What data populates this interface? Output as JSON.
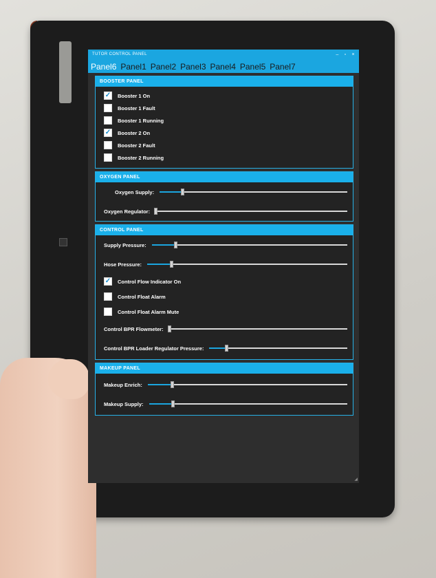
{
  "window": {
    "title": "TUTOR CONTROL PANEL",
    "controls": [
      "–",
      "▫",
      "×"
    ]
  },
  "tabs": [
    "Panel6",
    "Panel1",
    "Panel2",
    "Panel3",
    "Panel4",
    "Panel5",
    "Panel7"
  ],
  "booster": {
    "title": "BOOSTER PANEL",
    "items": [
      {
        "label": "Booster 1 On",
        "checked": true
      },
      {
        "label": "Booster 1 Fault",
        "checked": false
      },
      {
        "label": "Booster 1 Running",
        "checked": false
      },
      {
        "label": "Booster 2 On",
        "checked": true
      },
      {
        "label": "Booster 2 Fault",
        "checked": false
      },
      {
        "label": "Booster 2 Running",
        "checked": false
      }
    ]
  },
  "oxygen": {
    "title": "OXYGEN PANEL",
    "sliders": [
      {
        "label": "Oxygen Supply:",
        "value": 0.12
      },
      {
        "label": "Oxygen Regulator:",
        "value": 0.0
      }
    ]
  },
  "control": {
    "title": "CONTROL PANEL",
    "supply_pressure": {
      "label": "Supply Pressure:",
      "value": 0.12
    },
    "hose_pressure": {
      "label": "Hose Pressure:",
      "value": 0.12
    },
    "checks": [
      {
        "label": "Control Flow Indicator On",
        "checked": true
      },
      {
        "label": "Control Float Alarm",
        "checked": false
      },
      {
        "label": "Control Float Alarm Mute",
        "checked": false
      }
    ],
    "bpr_flowmeter": {
      "label": "Control BPR Flowmeter:",
      "value": 0.0
    },
    "bpr_loader": {
      "label": "Control BPR Loader Regulator Pressure:",
      "value": 0.12
    }
  },
  "makeup": {
    "title": "MAKEUP PANEL",
    "sliders": [
      {
        "label": "Makeup Enrich:",
        "value": 0.12
      },
      {
        "label": "Makeup Supply:",
        "value": 0.12
      }
    ]
  },
  "colors": {
    "accent": "#1ba6e0",
    "panel_bg": "#232323",
    "screen_bg": "#2e2e2e"
  },
  "icons": {
    "check": "✓",
    "grip": "◢"
  }
}
